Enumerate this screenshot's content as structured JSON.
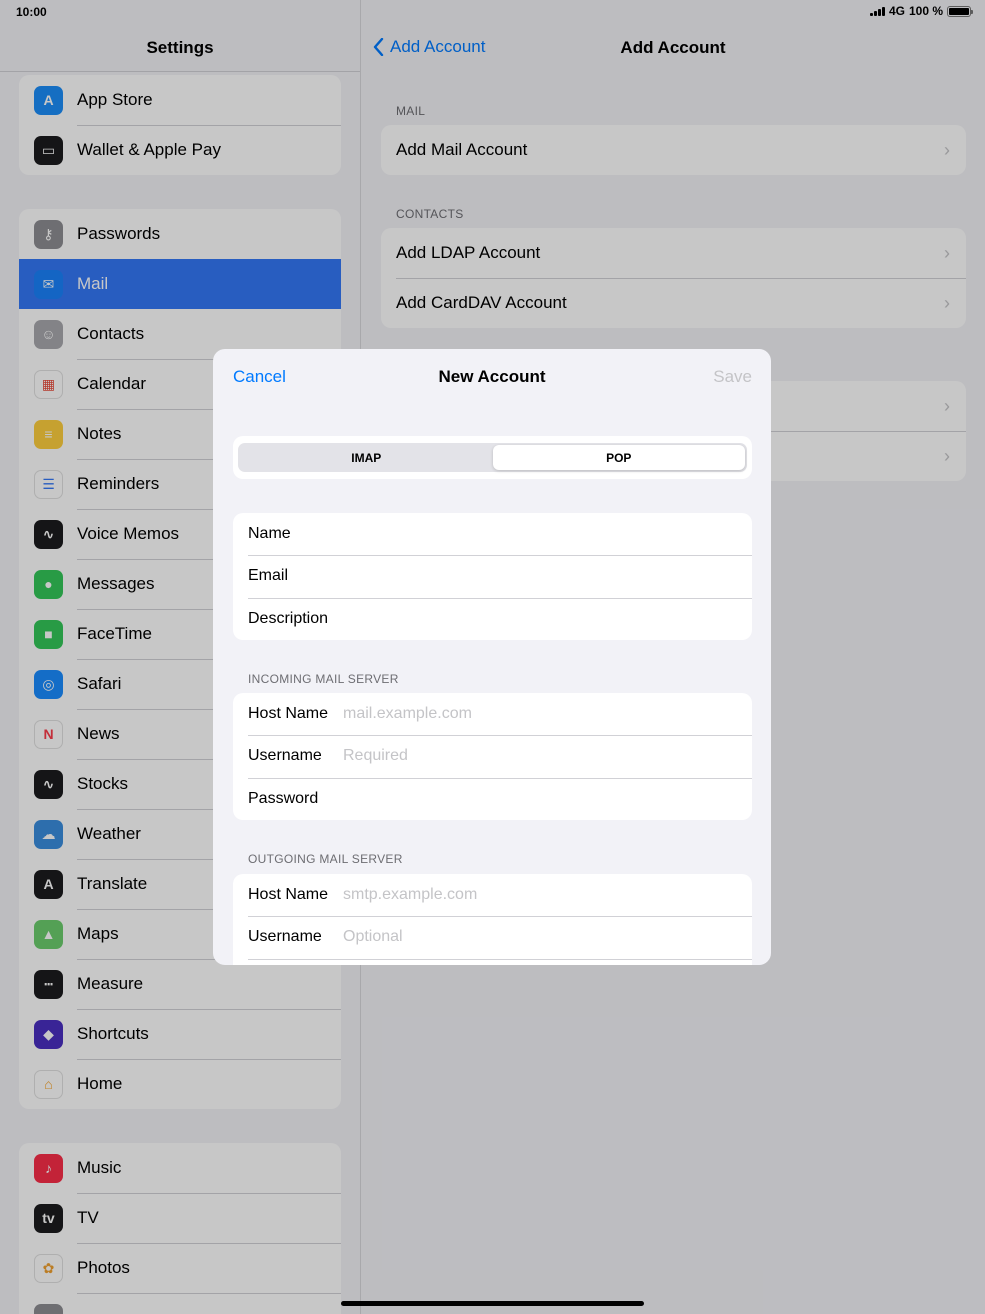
{
  "status": {
    "time": "10:00",
    "network": "4G",
    "battery": "100 %",
    "battery_level": 1.0
  },
  "sidebar": {
    "title": "Settings",
    "groups": [
      [
        {
          "label": "App Store",
          "icon": "app-store-icon",
          "color": "#1c8ef9"
        },
        {
          "label": "Wallet & Apple Pay",
          "icon": "wallet-icon",
          "color": "#1c1c1e"
        }
      ],
      [
        {
          "label": "Passwords",
          "icon": "key-icon",
          "color": "#8e8e93"
        },
        {
          "label": "Mail",
          "icon": "mail-icon",
          "color": "#1a82fb",
          "active": true
        },
        {
          "label": "Contacts",
          "icon": "contacts-icon",
          "color": "#a8a8ad"
        },
        {
          "label": "Calendar",
          "icon": "calendar-icon",
          "color": "#ffffff"
        },
        {
          "label": "Notes",
          "icon": "notes-icon",
          "color": "#fecf3e"
        },
        {
          "label": "Reminders",
          "icon": "reminders-icon",
          "color": "#ffffff"
        },
        {
          "label": "Voice Memos",
          "icon": "voice-memos-icon",
          "color": "#1c1c1e"
        },
        {
          "label": "Messages",
          "icon": "messages-icon",
          "color": "#34c759"
        },
        {
          "label": "FaceTime",
          "icon": "facetime-icon",
          "color": "#34c759"
        },
        {
          "label": "Safari",
          "icon": "safari-icon",
          "color": "#1a8cff"
        },
        {
          "label": "News",
          "icon": "news-icon",
          "color": "#ffffff"
        },
        {
          "label": "Stocks",
          "icon": "stocks-icon",
          "color": "#1c1c1e"
        },
        {
          "label": "Weather",
          "icon": "weather-icon",
          "color": "#3a8dde"
        },
        {
          "label": "Translate",
          "icon": "translate-icon",
          "color": "#1c1c1e"
        },
        {
          "label": "Maps",
          "icon": "maps-icon",
          "color": "#6ccd6e"
        },
        {
          "label": "Measure",
          "icon": "measure-icon",
          "color": "#1c1c1e"
        },
        {
          "label": "Shortcuts",
          "icon": "shortcuts-icon",
          "color": "#4a2fc0"
        },
        {
          "label": "Home",
          "icon": "home-icon",
          "color": "#ffffff"
        }
      ],
      [
        {
          "label": "Music",
          "icon": "music-icon",
          "color": "#fa2d48"
        },
        {
          "label": "TV",
          "icon": "tv-icon",
          "color": "#1c1c1e"
        },
        {
          "label": "Photos",
          "icon": "photos-icon",
          "color": "#ffffff"
        },
        {
          "label": "",
          "icon": "camera-icon",
          "color": "#8e8e93"
        }
      ]
    ]
  },
  "detail": {
    "back_label": "Add Account",
    "title": "Add Account",
    "sections": [
      {
        "label": "MAIL",
        "rows": [
          "Add Mail Account"
        ]
      },
      {
        "label": "CONTACTS",
        "rows": [
          "Add LDAP Account",
          "Add CardDAV Account"
        ]
      },
      {
        "label": "",
        "rows": [
          "",
          ""
        ]
      }
    ]
  },
  "modal": {
    "cancel_label": "Cancel",
    "title": "New Account",
    "save_label": "Save",
    "segments": [
      "IMAP",
      "POP"
    ],
    "selected_segment": "POP",
    "account_fields": [
      {
        "label": "Name",
        "placeholder": ""
      },
      {
        "label": "Email",
        "placeholder": ""
      },
      {
        "label": "Description",
        "placeholder": ""
      }
    ],
    "incoming": {
      "label": "INCOMING MAIL SERVER",
      "fields": [
        {
          "label": "Host Name",
          "placeholder": "mail.example.com"
        },
        {
          "label": "Username",
          "placeholder": "Required"
        },
        {
          "label": "Password",
          "placeholder": ""
        }
      ]
    },
    "outgoing": {
      "label": "OUTGOING MAIL SERVER",
      "fields": [
        {
          "label": "Host Name",
          "placeholder": "smtp.example.com"
        },
        {
          "label": "Username",
          "placeholder": "Optional"
        },
        {
          "label": "",
          "placeholder": ""
        }
      ]
    }
  }
}
